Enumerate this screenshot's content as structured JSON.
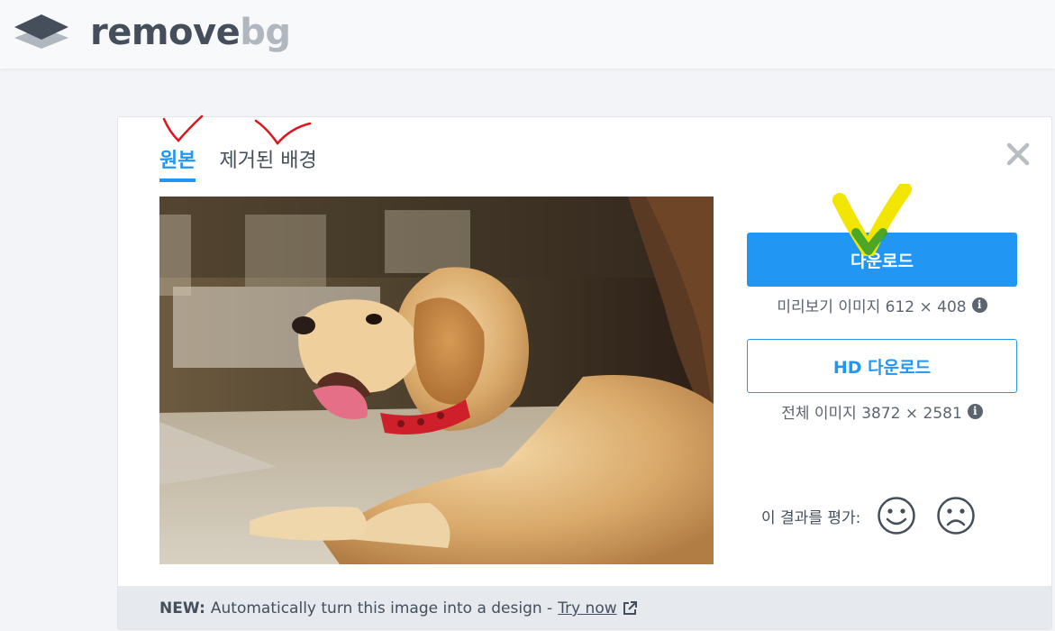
{
  "header": {
    "logo_text_main": "remove",
    "logo_text_accent": "bg",
    "logo_icon": "layers-icon"
  },
  "tabs": [
    {
      "label": "원본",
      "active": true
    },
    {
      "label": "제거된 배경",
      "active": false
    }
  ],
  "close_icon": "close-icon",
  "preview": {
    "image_description": "golden retriever puppy lying down",
    "download_button": "다운로드",
    "preview_info": "미리보기 이미지 612 × 408",
    "hd_button": "HD 다운로드",
    "full_info": "전체 이미지 3872 × 2581",
    "info_icon": "info-icon"
  },
  "rating": {
    "label": "이 결과를 평가:",
    "happy_icon": "smile-face-icon",
    "sad_icon": "sad-face-icon"
  },
  "footer": {
    "new_label": "NEW:",
    "text": "Automatically turn this image into a design -",
    "link_text": "Try now",
    "link_icon": "external-link-icon"
  },
  "colors": {
    "accent": "#2196f3",
    "text": "#454f5b",
    "annotation_red": "#e0141e",
    "annotation_yellow": "#f2e600",
    "annotation_green": "#3aa02c"
  }
}
